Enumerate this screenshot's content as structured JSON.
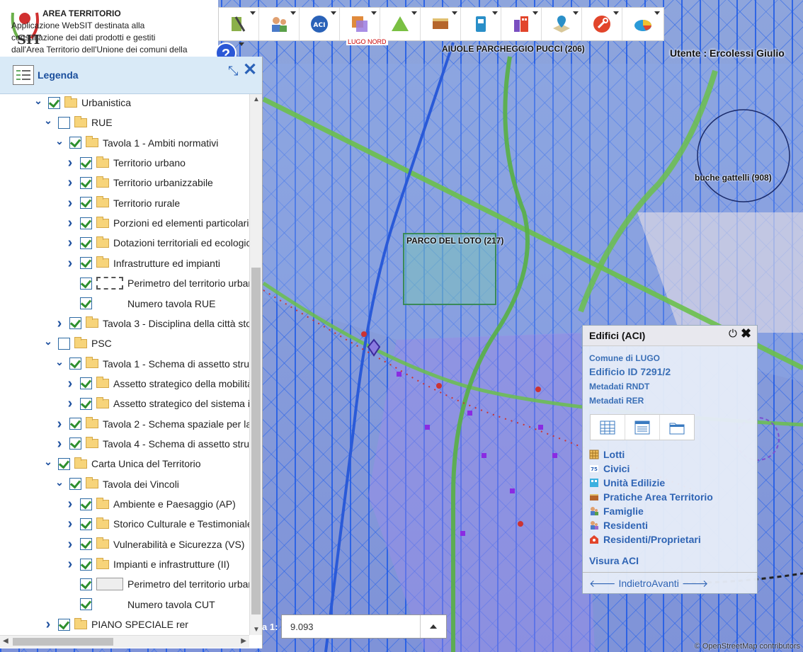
{
  "app": {
    "title": "AREA TERRITORIO",
    "description_lines": [
      "Applicazione WebSIT destinata alla",
      "consultazione dei dati prodotti e gestiti",
      "dall'Area Territorio dell'Unione dei comuni della"
    ],
    "help_label": "?"
  },
  "toolbar": {
    "buttons": [
      {
        "icon": "layers-road-icon",
        "color": "#8bb04a"
      },
      {
        "icon": "users-icon",
        "color": "#4a7ac8"
      },
      {
        "icon": "aci-icon",
        "color": "#2a62b8",
        "label": "ACI"
      },
      {
        "icon": "overlay-squares-icon",
        "color": "#e08a3c"
      },
      {
        "icon": "recycle-icon",
        "color": "#7ac043"
      },
      {
        "icon": "wall-icon",
        "color": "#b5652b"
      },
      {
        "icon": "document-book-icon",
        "color": "#2a8fc8"
      },
      {
        "icon": "building-icon",
        "color": "#7a4fc0"
      },
      {
        "icon": "map-pin-icon",
        "color": "#d04040"
      },
      {
        "icon": "wrench-icon",
        "color": "#e2452b"
      },
      {
        "icon": "pie-chart-icon",
        "color": "#2a9ad8"
      }
    ]
  },
  "map": {
    "user": "Utente : Ercolessi Giulio",
    "labels": {
      "aiuole": "AIUOLE PARCHEGGIO PUCCI (206)",
      "parco": "PARCO DEL LOTO (217)",
      "buche": "buche gattelli (908)",
      "lugo_nord": "LUGO NORD"
    },
    "attribution": "© OpenStreetMap contributors"
  },
  "legend": {
    "title": "Legenda",
    "items": [
      {
        "label": "Urbanistica",
        "level": 1,
        "expander": "open",
        "checked": true,
        "swatch": "folder"
      },
      {
        "label": "RUE",
        "level": 2,
        "expander": "open",
        "checked": false,
        "swatch": "folder"
      },
      {
        "label": "Tavola 1 - Ambiti normativi",
        "level": 3,
        "expander": "open",
        "checked": true,
        "swatch": "folder"
      },
      {
        "label": "Territorio urbano",
        "level": 4,
        "expander": "closed",
        "checked": true,
        "swatch": "folder"
      },
      {
        "label": "Territorio urbanizzabile",
        "level": 4,
        "expander": "closed",
        "checked": true,
        "swatch": "folder"
      },
      {
        "label": "Territorio rurale",
        "level": 4,
        "expander": "closed",
        "checked": true,
        "swatch": "folder"
      },
      {
        "label": "Porzioni ed elementi particolari",
        "level": 4,
        "expander": "closed",
        "checked": true,
        "swatch": "folder"
      },
      {
        "label": "Dotazioni territoriali ed ecologic",
        "level": 4,
        "expander": "closed",
        "checked": true,
        "swatch": "folder"
      },
      {
        "label": "Infrastrutture ed impianti",
        "level": 4,
        "expander": "closed",
        "checked": true,
        "swatch": "folder"
      },
      {
        "label": "Perimetro del territorio urbar",
        "level": 4,
        "expander": "none",
        "checked": true,
        "swatch": "dash"
      },
      {
        "label": "Numero tavola RUE",
        "level": 4,
        "expander": "none",
        "checked": true,
        "swatch": "blank"
      },
      {
        "label": "Tavola 3 - Disciplina della città sto",
        "level": 3,
        "expander": "closed",
        "checked": true,
        "swatch": "folder"
      },
      {
        "label": "PSC",
        "level": 2,
        "expander": "open",
        "checked": false,
        "swatch": "folder"
      },
      {
        "label": "Tavola 1 - Schema di assetto strut",
        "level": 3,
        "expander": "open",
        "checked": true,
        "swatch": "folder"
      },
      {
        "label": "Assetto strategico della mobilità",
        "level": 4,
        "expander": "closed",
        "checked": true,
        "swatch": "folder"
      },
      {
        "label": "Assetto strategico del sistema ir",
        "level": 4,
        "expander": "closed",
        "checked": true,
        "swatch": "folder"
      },
      {
        "label": "Tavola 2 - Schema spaziale per la",
        "level": 3,
        "expander": "closed",
        "checked": true,
        "swatch": "folder"
      },
      {
        "label": "Tavola 4 - Schema di assetto strut",
        "level": 3,
        "expander": "closed",
        "checked": true,
        "swatch": "folder"
      },
      {
        "label": "Carta Unica del Territorio",
        "level": 2,
        "expander": "open",
        "checked": true,
        "swatch": "folder"
      },
      {
        "label": "Tavola dei Vincoli",
        "level": 3,
        "expander": "open",
        "checked": true,
        "swatch": "folder"
      },
      {
        "label": "Ambiente e Paesaggio (AP)",
        "level": 4,
        "expander": "closed",
        "checked": true,
        "swatch": "folder"
      },
      {
        "label": "Storico Culturale e Testimoniale",
        "level": 4,
        "expander": "closed",
        "checked": true,
        "swatch": "folder"
      },
      {
        "label": "Vulnerabilità e Sicurezza (VS)",
        "level": 4,
        "expander": "closed",
        "checked": true,
        "swatch": "folder"
      },
      {
        "label": "Impianti e infrastrutture (II)",
        "level": 4,
        "expander": "closed",
        "checked": true,
        "swatch": "folder"
      },
      {
        "label": "Perimetro del territorio urbar",
        "level": 4,
        "expander": "none",
        "checked": true,
        "swatch": "box"
      },
      {
        "label": "Numero tavola CUT",
        "level": 4,
        "expander": "none",
        "checked": true,
        "swatch": "blank"
      },
      {
        "label": "PIANO SPECIALE rer",
        "level": 2,
        "expander": "closed",
        "checked": true,
        "swatch": "folder"
      }
    ]
  },
  "scale": {
    "prefix": "a 1:",
    "value": "9.093"
  },
  "popup": {
    "title": "Edifici (ACI)",
    "comune": "Comune di LUGO",
    "edificio": "Edificio ID 7291/2",
    "metadati_rndt": "Metadati RNDT",
    "metadati_rer": "Metadati RER",
    "links": [
      {
        "label": "Lotti",
        "icon": "grid-icon"
      },
      {
        "label": "Civici",
        "icon": "house-number-icon"
      },
      {
        "label": "Unità Edilizie",
        "icon": "building-units-icon"
      },
      {
        "label": "Pratiche Area Territorio",
        "icon": "wall-icon"
      },
      {
        "label": "Famiglie",
        "icon": "family-icon"
      },
      {
        "label": "Residenti",
        "icon": "residents-icon"
      },
      {
        "label": "Residenti/Proprietari",
        "icon": "owners-icon"
      }
    ],
    "visura": "Visura ACI",
    "nav_back": "Indietro",
    "nav_forward": "Avanti"
  }
}
